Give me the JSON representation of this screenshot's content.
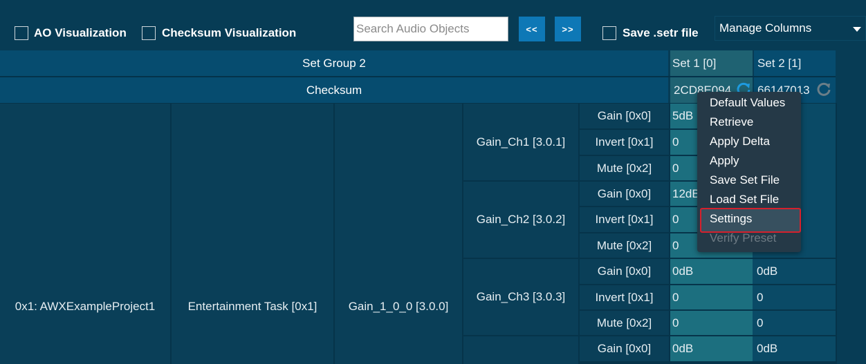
{
  "toolbar": {
    "ao_visualization_label": "AO Visualization",
    "checksum_visualization_label": "Checksum Visualization",
    "search_placeholder": "Search Audio Objects",
    "prev_label": "<<",
    "next_label": ">>",
    "save_setr_label": "Save .setr file",
    "manage_columns_label": "Manage Columns"
  },
  "header": {
    "set_group": "Set Group 2",
    "checksum": "Checksum",
    "sets": [
      {
        "label": "Set 1 [0]",
        "checksum": "2CD8E094"
      },
      {
        "label": "Set 2 [1]",
        "checksum": "66147013"
      }
    ]
  },
  "tree": {
    "project": "0x1: AWXExampleProject1",
    "task": "Entertainment Task [0x1]",
    "object": "Gain_1_0_0 [3.0.0]",
    "channels": [
      {
        "name": "Gain_Ch1 [3.0.1]",
        "params": [
          {
            "name": "Gain [0x0]",
            "set1": "5dB",
            "set2": ""
          },
          {
            "name": "Invert [0x1]",
            "set1": "0",
            "set2": ""
          },
          {
            "name": "Mute [0x2]",
            "set1": "0",
            "set2": ""
          }
        ]
      },
      {
        "name": "Gain_Ch2 [3.0.2]",
        "params": [
          {
            "name": "Gain [0x0]",
            "set1": "12dB",
            "set2": ""
          },
          {
            "name": "Invert [0x1]",
            "set1": "0",
            "set2": ""
          },
          {
            "name": "Mute [0x2]",
            "set1": "0",
            "set2": ""
          }
        ]
      },
      {
        "name": "Gain_Ch3 [3.0.3]",
        "params": [
          {
            "name": "Gain [0x0]",
            "set1": "0dB",
            "set2": "0dB"
          },
          {
            "name": "Invert [0x1]",
            "set1": "0",
            "set2": "0"
          },
          {
            "name": "Mute [0x2]",
            "set1": "0",
            "set2": "0"
          }
        ]
      },
      {
        "name": "",
        "params": [
          {
            "name": "Gain [0x0]",
            "set1": "0dB",
            "set2": "0dB"
          }
        ]
      }
    ]
  },
  "context_menu": {
    "items": [
      {
        "label": "Default Values",
        "enabled": true,
        "highlighted": false
      },
      {
        "label": "Retrieve",
        "enabled": true,
        "highlighted": false
      },
      {
        "label": "Apply Delta",
        "enabled": true,
        "highlighted": false
      },
      {
        "label": "Apply",
        "enabled": true,
        "highlighted": false
      },
      {
        "label": "Save Set File",
        "enabled": true,
        "highlighted": false
      },
      {
        "label": "Load Set File",
        "enabled": true,
        "highlighted": false
      },
      {
        "label": "Settings",
        "enabled": true,
        "highlighted": true
      },
      {
        "label": "Verify Preset",
        "enabled": false,
        "highlighted": false
      }
    ]
  },
  "icons": {
    "refresh_active": "refresh-icon",
    "refresh_inactive": "refresh-icon"
  },
  "colors": {
    "background": "#073c55",
    "header": "#064c6f",
    "value_cell": "#1c6f7f",
    "accent_button": "#0e78b6",
    "highlight_border": "#d6202c"
  }
}
